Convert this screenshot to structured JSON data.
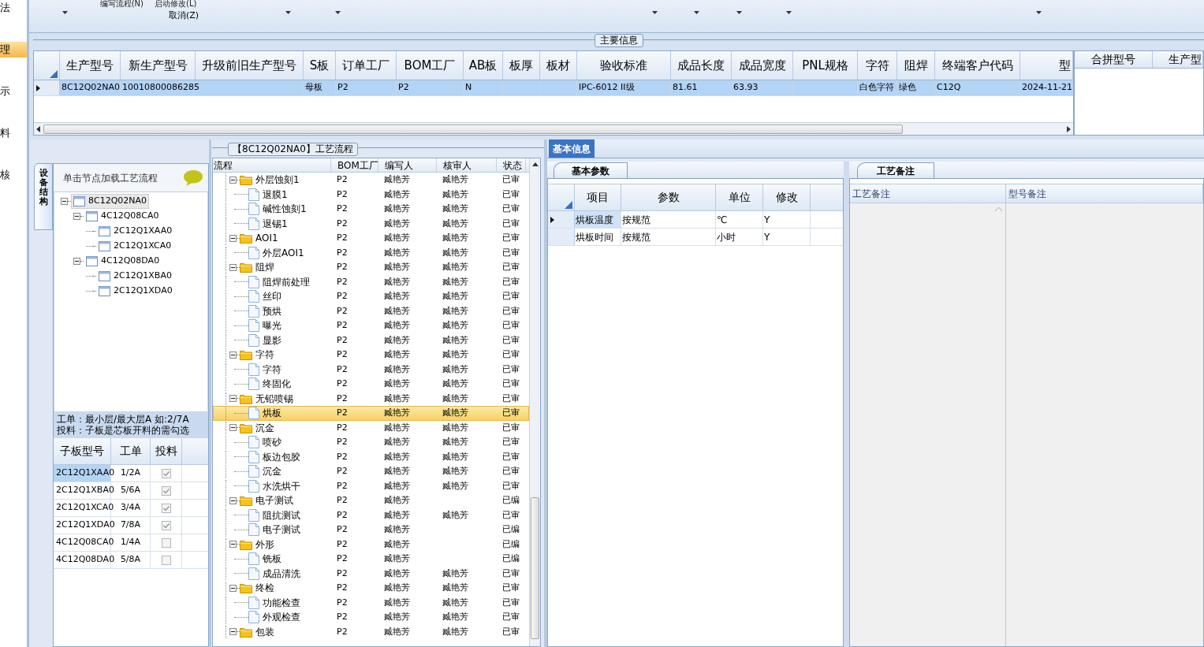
{
  "nav": [
    {
      "label": "法",
      "selected": false
    },
    {
      "label": "理",
      "selected": true
    },
    {
      "label": "示",
      "selected": false
    },
    {
      "label": "料",
      "selected": false
    },
    {
      "label": "核",
      "selected": false
    }
  ],
  "ribbon": {
    "top_commands": [
      "编写流程(N)",
      "启动修改(L)"
    ],
    "command": "取消(Z)"
  },
  "main_info": {
    "title": "主要信息",
    "columns": [
      "生产型号",
      "新生产型号",
      "升级前旧生产型号",
      "S板",
      "订单工厂",
      "BOM工厂",
      "AB板",
      "板厚",
      "板材",
      "验收标准",
      "成品长度",
      "成品宽度",
      "PNL规格",
      "字符",
      "阻焊",
      "终端客户代码",
      "型"
    ],
    "rows": [
      {
        "selected": true,
        "cells": [
          "8C12Q02NA0",
          "10010800086285",
          "",
          "母板",
          "P2",
          "P2",
          "N",
          "",
          "",
          "IPC-6012 II级",
          "81.61",
          "63.93",
          "",
          "白色字符",
          "绿色",
          "C12Q",
          "2024-11-21"
        ]
      }
    ]
  },
  "merge_grid": {
    "columns": [
      "合拼型号",
      "生产型"
    ]
  },
  "structure_tab": {
    "label": "设备结构"
  },
  "structure_tree": {
    "hint": "单击节点加载工艺流程",
    "nodes": [
      {
        "label": "8C12Q02NA0",
        "selected": true,
        "expanded": true,
        "children": [
          {
            "label": "4C12Q08CA0",
            "selected": false,
            "expanded": true,
            "children": [
              {
                "label": "2C12Q1XAA0",
                "selected": false
              },
              {
                "label": "2C12Q1XCA0",
                "selected": false
              }
            ]
          },
          {
            "label": "4C12Q08DA0",
            "selected": false,
            "expanded": true,
            "children": [
              {
                "label": "2C12Q1XBA0",
                "selected": false
              },
              {
                "label": "2C12Q1XDA0",
                "selected": false
              }
            ]
          }
        ]
      }
    ]
  },
  "notes": [
    "工单：最小层/最大层A 如:2/7A",
    "投料：子板是芯板开料的需勾选"
  ],
  "sub_boards": {
    "columns": [
      "子板型号",
      "工单",
      "投料"
    ],
    "rows": [
      {
        "model": "2C12Q1XAA0",
        "order": "1/2A",
        "checked": true,
        "selected": true
      },
      {
        "model": "2C12Q1XBA0",
        "order": "5/6A",
        "checked": true,
        "selected": false
      },
      {
        "model": "2C12Q1XCA0",
        "order": "3/4A",
        "checked": true,
        "selected": false
      },
      {
        "model": "2C12Q1XDA0",
        "order": "7/8A",
        "checked": true,
        "selected": false
      },
      {
        "model": "4C12Q08CA0",
        "order": "1/4A",
        "checked": false,
        "selected": false
      },
      {
        "model": "4C12Q08DA0",
        "order": "5/8A",
        "checked": false,
        "selected": false
      }
    ]
  },
  "process_flow": {
    "title": "【8C12Q02NA0】工艺流程",
    "columns": [
      "流程",
      "BOM工厂",
      "编写人",
      "核审人",
      "状态"
    ],
    "steps": [
      {
        "name": "外层蚀刻1",
        "factory": "P2",
        "writer": "臧艳芳",
        "reviewer": "臧艳芳",
        "status": "已审",
        "expanded": true,
        "selected": false,
        "children": [
          {
            "name": "退膜1",
            "factory": "P2",
            "writer": "臧艳芳",
            "reviewer": "臧艳芳",
            "status": "已审",
            "selected": false
          },
          {
            "name": "碱性蚀刻1",
            "factory": "P2",
            "writer": "臧艳芳",
            "reviewer": "臧艳芳",
            "status": "已审",
            "selected": false
          },
          {
            "name": "退锡1",
            "factory": "P2",
            "writer": "臧艳芳",
            "reviewer": "臧艳芳",
            "status": "已审",
            "selected": false
          }
        ]
      },
      {
        "name": "AOI1",
        "factory": "P2",
        "writer": "臧艳芳",
        "reviewer": "臧艳芳",
        "status": "已审",
        "expanded": true,
        "selected": false,
        "children": [
          {
            "name": "外层AOI1",
            "factory": "P2",
            "writer": "臧艳芳",
            "reviewer": "臧艳芳",
            "status": "已审",
            "selected": false
          }
        ]
      },
      {
        "name": "阻焊",
        "factory": "P2",
        "writer": "臧艳芳",
        "reviewer": "臧艳芳",
        "status": "已审",
        "expanded": true,
        "selected": false,
        "children": [
          {
            "name": "阻焊前处理",
            "factory": "P2",
            "writer": "臧艳芳",
            "reviewer": "臧艳芳",
            "status": "已审",
            "selected": false
          },
          {
            "name": "丝印",
            "factory": "P2",
            "writer": "臧艳芳",
            "reviewer": "臧艳芳",
            "status": "已审",
            "selected": false
          },
          {
            "name": "预烘",
            "factory": "P2",
            "writer": "臧艳芳",
            "reviewer": "臧艳芳",
            "status": "已审",
            "selected": false
          },
          {
            "name": "曝光",
            "factory": "P2",
            "writer": "臧艳芳",
            "reviewer": "臧艳芳",
            "status": "已审",
            "selected": false
          },
          {
            "name": "显影",
            "factory": "P2",
            "writer": "臧艳芳",
            "reviewer": "臧艳芳",
            "status": "已审",
            "selected": false
          }
        ]
      },
      {
        "name": "字符",
        "factory": "P2",
        "writer": "臧艳芳",
        "reviewer": "臧艳芳",
        "status": "已审",
        "expanded": true,
        "selected": false,
        "children": [
          {
            "name": "字符",
            "factory": "P2",
            "writer": "臧艳芳",
            "reviewer": "臧艳芳",
            "status": "已审",
            "selected": false
          },
          {
            "name": "终固化",
            "factory": "P2",
            "writer": "臧艳芳",
            "reviewer": "臧艳芳",
            "status": "已审",
            "selected": false
          }
        ]
      },
      {
        "name": "无铅喷锡",
        "factory": "P2",
        "writer": "臧艳芳",
        "reviewer": "臧艳芳",
        "status": "已审",
        "expanded": true,
        "selected": false,
        "children": [
          {
            "name": "烘板",
            "factory": "P2",
            "writer": "臧艳芳",
            "reviewer": "臧艳芳",
            "status": "已审",
            "selected": true
          }
        ]
      },
      {
        "name": "沉金",
        "factory": "P2",
        "writer": "臧艳芳",
        "reviewer": "臧艳芳",
        "status": "已审",
        "expanded": true,
        "selected": false,
        "children": [
          {
            "name": "喷砂",
            "factory": "P2",
            "writer": "臧艳芳",
            "reviewer": "臧艳芳",
            "status": "已审",
            "selected": false
          },
          {
            "name": "板边包胶",
            "factory": "P2",
            "writer": "臧艳芳",
            "reviewer": "臧艳芳",
            "status": "已审",
            "selected": false
          },
          {
            "name": "沉金",
            "factory": "P2",
            "writer": "臧艳芳",
            "reviewer": "臧艳芳",
            "status": "已审",
            "selected": false
          },
          {
            "name": "水洗烘干",
            "factory": "P2",
            "writer": "臧艳芳",
            "reviewer": "臧艳芳",
            "status": "已审",
            "selected": false
          }
        ]
      },
      {
        "name": "电子测试",
        "factory": "P2",
        "writer": "臧艳芳",
        "status": "已编",
        "expanded": true,
        "selected": false,
        "children": [
          {
            "name": "阻抗测试",
            "factory": "P2",
            "writer": "臧艳芳",
            "reviewer": "臧艳芳",
            "status": "已审",
            "selected": false
          },
          {
            "name": "电子测试",
            "factory": "P2",
            "writer": "臧艳芳",
            "status": "已编",
            "selected": false
          }
        ]
      },
      {
        "name": "外形",
        "factory": "P2",
        "writer": "臧艳芳",
        "status": "已编",
        "expanded": true,
        "selected": false,
        "children": [
          {
            "name": "铣板",
            "factory": "P2",
            "writer": "臧艳芳",
            "status": "已编",
            "selected": false
          },
          {
            "name": "成品清洗",
            "factory": "P2",
            "writer": "臧艳芳",
            "reviewer": "臧艳芳",
            "status": "已审",
            "selected": false
          }
        ]
      },
      {
        "name": "终检",
        "factory": "P2",
        "writer": "臧艳芳",
        "reviewer": "臧艳芳",
        "status": "已审",
        "expanded": true,
        "selected": false,
        "children": [
          {
            "name": "功能检查",
            "factory": "P2",
            "writer": "臧艳芳",
            "reviewer": "臧艳芳",
            "status": "已审",
            "selected": false
          },
          {
            "name": "外观检查",
            "factory": "P2",
            "writer": "臧艳芳",
            "reviewer": "臧艳芳",
            "status": "已审",
            "selected": false
          }
        ]
      },
      {
        "name": "包装",
        "factory": "P2",
        "writer": "臧艳芳",
        "reviewer": "臧艳芳",
        "status": "已审",
        "expanded": true,
        "selected": false
      }
    ]
  },
  "detail_tabs": [
    {
      "label": "基本信息",
      "selected": true
    }
  ],
  "params": {
    "tab": "基本参数",
    "columns": [
      "项目",
      "参数",
      "单位",
      "修改"
    ],
    "rows": [
      {
        "selected": true,
        "cells": [
          "烘板温度",
          "按规范",
          "℃",
          "Y"
        ]
      },
      {
        "selected": false,
        "cells": [
          "烘板时间",
          "按规范",
          "小时",
          "Y"
        ]
      }
    ]
  },
  "remarks": {
    "tab": "工艺备注",
    "columns": [
      "工艺备注",
      "型号备注"
    ]
  }
}
